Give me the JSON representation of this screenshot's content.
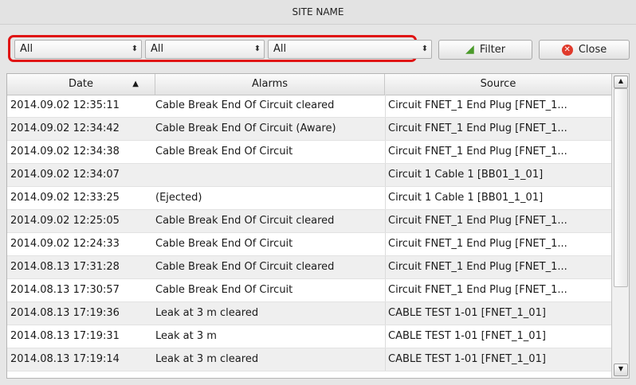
{
  "window": {
    "title": "SITE NAME"
  },
  "filters": {
    "select1": {
      "value": "All"
    },
    "select2": {
      "value": "All"
    },
    "select3": {
      "value": "All"
    },
    "filter_label": "Filter",
    "close_label": "Close",
    "highlight_color": "#e01414"
  },
  "table": {
    "columns": [
      "Date",
      "Alarms",
      "Source"
    ],
    "sort_indicator": "▲",
    "rows": [
      {
        "date": "2014.09.02 12:35:11",
        "alarm": "Cable Break End Of Circuit cleared",
        "source": "Circuit FNET_1 End Plug [FNET_1..."
      },
      {
        "date": "2014.09.02 12:34:42",
        "alarm": "Cable Break End Of Circuit (Aware)",
        "source": "Circuit FNET_1 End Plug [FNET_1..."
      },
      {
        "date": "2014.09.02 12:34:38",
        "alarm": "Cable Break End Of Circuit",
        "source": "Circuit FNET_1 End Plug [FNET_1..."
      },
      {
        "date": "2014.09.02 12:34:07",
        "alarm": "",
        "source": "Circuit 1 Cable 1 [BB01_1_01]"
      },
      {
        "date": "2014.09.02 12:33:25",
        "alarm": " (Ejected)",
        "source": "Circuit 1 Cable 1 [BB01_1_01]"
      },
      {
        "date": "2014.09.02 12:25:05",
        "alarm": "Cable Break End Of Circuit cleared",
        "source": "Circuit FNET_1 End Plug [FNET_1..."
      },
      {
        "date": "2014.09.02 12:24:33",
        "alarm": "Cable Break End Of Circuit",
        "source": "Circuit FNET_1 End Plug [FNET_1..."
      },
      {
        "date": "2014.08.13 17:31:28",
        "alarm": "Cable Break End Of Circuit cleared",
        "source": "Circuit FNET_1 End Plug [FNET_1..."
      },
      {
        "date": "2014.08.13 17:30:57",
        "alarm": "Cable Break End Of Circuit",
        "source": "Circuit FNET_1 End Plug [FNET_1..."
      },
      {
        "date": "2014.08.13 17:19:36",
        "alarm": "Leak at 3 m  cleared",
        "source": "CABLE TEST 1-01 [FNET_1_01]"
      },
      {
        "date": "2014.08.13 17:19:31",
        "alarm": "Leak at 3 m",
        "source": "CABLE TEST 1-01 [FNET_1_01]"
      },
      {
        "date": "2014.08.13 17:19:14",
        "alarm": "Leak at 3 m  cleared",
        "source": "CABLE TEST 1-01 [FNET_1_01]"
      }
    ]
  },
  "icons": {
    "filter": "funnel-icon",
    "close": "close-circle-icon",
    "select_arrows": "updown-arrows-icon",
    "scroll_up": "scroll-up-icon",
    "scroll_down": "scroll-down-icon"
  }
}
